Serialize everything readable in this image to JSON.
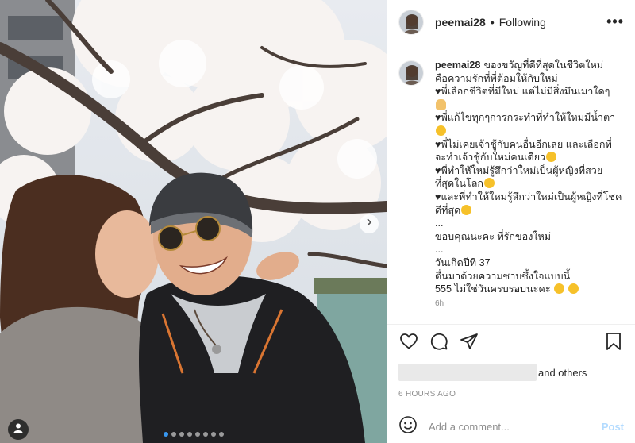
{
  "post": {
    "username": "peemai28",
    "header_separator": "•",
    "follow_status": "Following",
    "more_glyph": "•••",
    "caption_lines": [
      "ของขวัญที่ดีที่สุดในชีวิตใหม่",
      "คือความรักที่พี่ต้อมให้กับใหม่",
      "♥พี่เลือกชีวิตที่มีใหม่ แต่ไม่มีสิ่งมึนเมาใดๆ",
      "♥พี่แก้ไขทุกๆการกระทำที่ทำให้ใหม่มีน้ำตา",
      "♥พี่ไม่เคยเจ้าชู้กับคนอื่นอีกเลย และเลือกที่",
      "จะทำเจ้าชู้กับใหม่คนเดียว",
      "♥พี่ทำให้ใหม่รู้สึกว่าใหม่เป็นผู้หญิงที่สวย",
      "ที่สุดในโลก",
      "♥และพี่ทำให้ใหม่รู้สึกว่าใหม่เป็นผู้หญิงที่โชค",
      "ดีที่สุด",
      "...",
      "ขอบคุณนะคะ ที่รักของใหม่",
      "...",
      "วันเกิดปีที่ 37",
      "ตื่นมาด้วยความซาบซึ้งใจแบบนี้",
      "555 ไม่ใช่วันครบรอบนะคะ"
    ],
    "caption_time": "6h",
    "likes_suffix": "and others",
    "posted_ago": "6 HOURS AGO",
    "comment_placeholder": "Add a comment...",
    "post_label": "Post",
    "carousel_count": 8,
    "carousel_active_index": 0
  },
  "icons": {
    "like": "heart-outline-icon",
    "comment": "speech-bubble-icon",
    "share": "paper-plane-icon",
    "save": "bookmark-icon",
    "tag": "person-tag-icon",
    "next": "chevron-right-icon",
    "emoji": "smiley-icon"
  },
  "colors": {
    "accent_blue": "#3897f0",
    "post_disabled": "#b3dbff",
    "muted_text": "#8e8e8e"
  }
}
